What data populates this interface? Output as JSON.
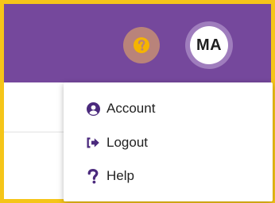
{
  "header": {
    "help_icon": "question-circle-icon",
    "avatar_initials": "MA"
  },
  "user_menu": {
    "items": [
      {
        "label": "Account",
        "icon": "user-circle-icon"
      },
      {
        "label": "Logout",
        "icon": "sign-out-icon"
      },
      {
        "label": "Help",
        "icon": "question-mark-icon"
      }
    ]
  },
  "colors": {
    "header_bg": "#75489c",
    "frame_border": "#f5c518",
    "help_bg": "#b9837a",
    "help_glyph": "#f5b400",
    "avatar_ring": "#9f7dbd",
    "menu_icon": "#4b2a7d"
  }
}
